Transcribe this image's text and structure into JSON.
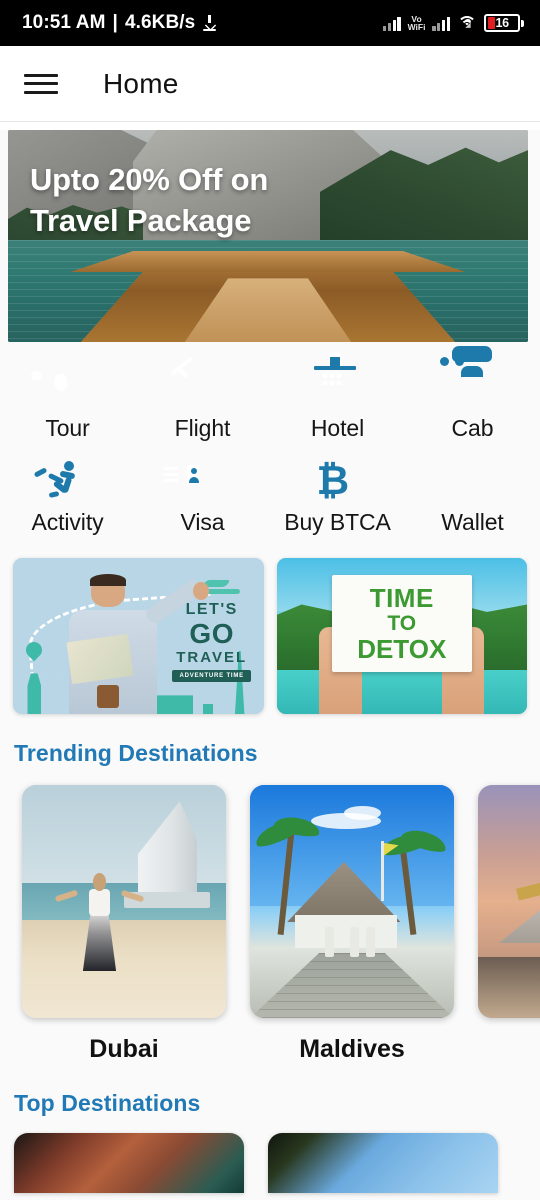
{
  "status_bar": {
    "time": "10:51 AM",
    "separator": "|",
    "network_speed": "4.6KB/s",
    "download_icon": "download-icon",
    "volte_line1": "Vo",
    "volte_line2": "WiFi",
    "wifi_icon": "wifi-icon",
    "signal_icon": "signal-bars-icon",
    "battery_level": "16"
  },
  "app_bar": {
    "menu_icon": "hamburger-menu-icon",
    "title": "Home"
  },
  "hero_banner": {
    "headline_line1": "Upto 20% Off on",
    "headline_line2": "Travel Package",
    "image_alt": "wooden boat on alpine lake with mountains"
  },
  "quick_actions": {
    "row1": [
      {
        "label": "Tour",
        "icon": "globe-icon"
      },
      {
        "label": "Flight",
        "icon": "airplane-ticket-icon"
      },
      {
        "label": "Hotel",
        "icon": "hotel-building-icon"
      },
      {
        "label": "Cab",
        "icon": "taxi-icon"
      }
    ],
    "row2": [
      {
        "label": "Activity",
        "icon": "running-person-icon"
      },
      {
        "label": "Visa",
        "icon": "id-card-icon"
      },
      {
        "label": "Buy BTCA",
        "icon": "bitcoin-icon"
      },
      {
        "label": "Wallet",
        "icon": "wallet-icon"
      }
    ],
    "accent_color": "#1d7aab"
  },
  "promos": [
    {
      "name": "lets-go-travel",
      "text_line1": "LET'S",
      "text_line2": "GO",
      "text_line3": "TRAVEL",
      "badge": "ADVENTURE TIME",
      "image_alt": "man with map pointing at plane with landmark silhouettes"
    },
    {
      "name": "time-to-detox",
      "sign_line1": "TIME",
      "sign_line2": "TO",
      "sign_line3": "DETOX",
      "image_alt": "hands holding sign on tropical beach"
    }
  ],
  "trending": {
    "title": "Trending Destinations",
    "title_color": "#2179b5",
    "items": [
      {
        "name": "Dubai",
        "image_alt": "woman on beach with Burj Al Arab"
      },
      {
        "name": "Maldives",
        "image_alt": "palm trees and thatched hut on boardwalk"
      },
      {
        "name": "",
        "image_alt": "temple at sunset"
      }
    ]
  },
  "top_destinations": {
    "title": "Top Destinations",
    "title_color": "#2179b5",
    "items": [
      {
        "name": "",
        "image_alt": "red brick architecture"
      },
      {
        "name": "",
        "image_alt": "blue sky with trees"
      }
    ]
  }
}
